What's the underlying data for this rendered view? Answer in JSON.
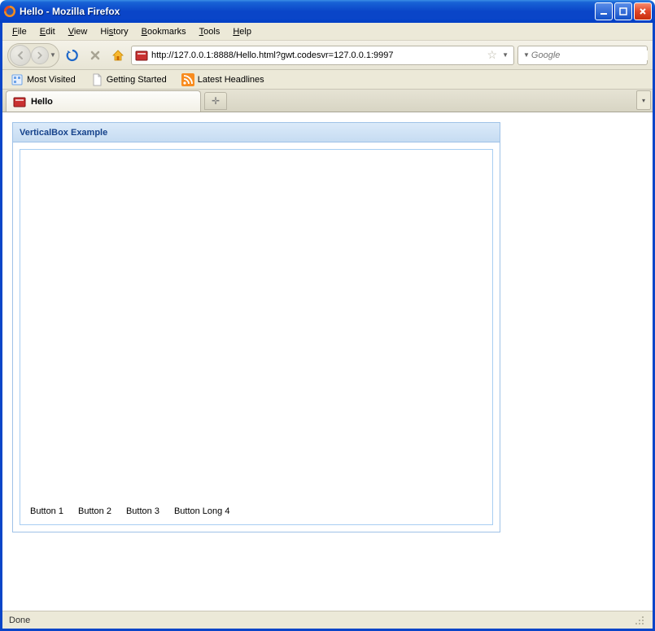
{
  "window": {
    "title": "Hello - Mozilla Firefox"
  },
  "menu": {
    "file": "File",
    "edit": "Edit",
    "view": "View",
    "history": "History",
    "bookmarks": "Bookmarks",
    "tools": "Tools",
    "help": "Help"
  },
  "url": "http://127.0.0.1:8888/Hello.html?gwt.codesvr=127.0.0.1:9997",
  "search": {
    "placeholder": "Google"
  },
  "bookmarks": {
    "most_visited": "Most Visited",
    "getting_started": "Getting Started",
    "latest_headlines": "Latest Headlines"
  },
  "tab": {
    "title": "Hello"
  },
  "panel": {
    "title": "VerticalBox Example",
    "buttons": [
      "Button 1",
      "Button 2",
      "Button 3",
      "Button Long 4"
    ]
  },
  "status": "Done"
}
